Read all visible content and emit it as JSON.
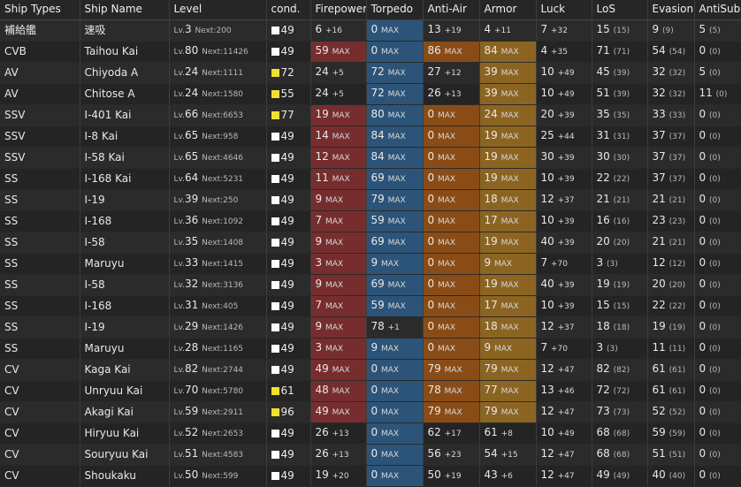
{
  "labels": {
    "lv": "Lv.",
    "next": "Next:",
    "max": "MAX"
  },
  "columns": [
    "Ship Types",
    "Ship Name",
    "Level",
    "cond.",
    "Firepower",
    "Torpedo",
    "Anti-Air",
    "Armor",
    "Luck",
    "LoS",
    "Evasion",
    "AntiSub"
  ],
  "colors": {
    "firepower_max": "#772d2d",
    "torpedo_max": "#2c5478",
    "antiair_max": "#8a4c16",
    "armor_max": "#8c6422",
    "cond_sparkle": "#f0e030",
    "cond_normal": "#ffffff"
  },
  "rows": [
    {
      "type": "補給艦",
      "name": "速吸",
      "lv": "3",
      "next": "200",
      "cond": "49",
      "condColor": "white",
      "fp": [
        "6",
        "+16"
      ],
      "tp": [
        "0",
        "MAX"
      ],
      "aa": [
        "13",
        "+19"
      ],
      "ar": [
        "4",
        "+11"
      ],
      "lk": [
        "7",
        "+32"
      ],
      "los": [
        "15",
        "(15)"
      ],
      "ev": [
        "9",
        "(9)"
      ],
      "as": [
        "5",
        "(5)"
      ]
    },
    {
      "type": "CVB",
      "name": "Taihou Kai",
      "lv": "80",
      "next": "11426",
      "cond": "49",
      "condColor": "white",
      "fp": [
        "59",
        "MAX"
      ],
      "tp": [
        "0",
        "MAX"
      ],
      "aa": [
        "86",
        "MAX"
      ],
      "ar": [
        "84",
        "MAX"
      ],
      "lk": [
        "4",
        "+35"
      ],
      "los": [
        "71",
        "(71)"
      ],
      "ev": [
        "54",
        "(54)"
      ],
      "as": [
        "0",
        "(0)"
      ]
    },
    {
      "type": "AV",
      "name": "Chiyoda A",
      "lv": "24",
      "next": "1111",
      "cond": "72",
      "condColor": "yellow",
      "fp": [
        "24",
        "+5"
      ],
      "tp": [
        "72",
        "MAX"
      ],
      "aa": [
        "27",
        "+12"
      ],
      "ar": [
        "39",
        "MAX"
      ],
      "lk": [
        "10",
        "+49"
      ],
      "los": [
        "45",
        "(39)"
      ],
      "ev": [
        "32",
        "(32)"
      ],
      "as": [
        "5",
        "(0)"
      ]
    },
    {
      "type": "AV",
      "name": "Chitose A",
      "lv": "24",
      "next": "1580",
      "cond": "55",
      "condColor": "yellow",
      "fp": [
        "24",
        "+5"
      ],
      "tp": [
        "72",
        "MAX"
      ],
      "aa": [
        "26",
        "+13"
      ],
      "ar": [
        "39",
        "MAX"
      ],
      "lk": [
        "10",
        "+49"
      ],
      "los": [
        "51",
        "(39)"
      ],
      "ev": [
        "32",
        "(32)"
      ],
      "as": [
        "11",
        "(0)"
      ]
    },
    {
      "type": "SSV",
      "name": "I-401 Kai",
      "lv": "66",
      "next": "6653",
      "cond": "77",
      "condColor": "yellow",
      "fp": [
        "19",
        "MAX"
      ],
      "tp": [
        "80",
        "MAX"
      ],
      "aa": [
        "0",
        "MAX"
      ],
      "ar": [
        "24",
        "MAX"
      ],
      "lk": [
        "20",
        "+39"
      ],
      "los": [
        "35",
        "(35)"
      ],
      "ev": [
        "33",
        "(33)"
      ],
      "as": [
        "0",
        "(0)"
      ]
    },
    {
      "type": "SSV",
      "name": "I-8 Kai",
      "lv": "65",
      "next": "958",
      "cond": "49",
      "condColor": "white",
      "fp": [
        "14",
        "MAX"
      ],
      "tp": [
        "84",
        "MAX"
      ],
      "aa": [
        "0",
        "MAX"
      ],
      "ar": [
        "19",
        "MAX"
      ],
      "lk": [
        "25",
        "+44"
      ],
      "los": [
        "31",
        "(31)"
      ],
      "ev": [
        "37",
        "(37)"
      ],
      "as": [
        "0",
        "(0)"
      ]
    },
    {
      "type": "SSV",
      "name": "I-58 Kai",
      "lv": "65",
      "next": "4646",
      "cond": "49",
      "condColor": "white",
      "fp": [
        "12",
        "MAX"
      ],
      "tp": [
        "84",
        "MAX"
      ],
      "aa": [
        "0",
        "MAX"
      ],
      "ar": [
        "19",
        "MAX"
      ],
      "lk": [
        "30",
        "+39"
      ],
      "los": [
        "30",
        "(30)"
      ],
      "ev": [
        "37",
        "(37)"
      ],
      "as": [
        "0",
        "(0)"
      ]
    },
    {
      "type": "SS",
      "name": "I-168 Kai",
      "lv": "64",
      "next": "5231",
      "cond": "49",
      "condColor": "white",
      "fp": [
        "11",
        "MAX"
      ],
      "tp": [
        "69",
        "MAX"
      ],
      "aa": [
        "0",
        "MAX"
      ],
      "ar": [
        "19",
        "MAX"
      ],
      "lk": [
        "10",
        "+39"
      ],
      "los": [
        "22",
        "(22)"
      ],
      "ev": [
        "37",
        "(37)"
      ],
      "as": [
        "0",
        "(0)"
      ]
    },
    {
      "type": "SS",
      "name": "I-19",
      "lv": "39",
      "next": "250",
      "cond": "49",
      "condColor": "white",
      "fp": [
        "9",
        "MAX"
      ],
      "tp": [
        "79",
        "MAX"
      ],
      "aa": [
        "0",
        "MAX"
      ],
      "ar": [
        "18",
        "MAX"
      ],
      "lk": [
        "12",
        "+37"
      ],
      "los": [
        "21",
        "(21)"
      ],
      "ev": [
        "21",
        "(21)"
      ],
      "as": [
        "0",
        "(0)"
      ]
    },
    {
      "type": "SS",
      "name": "I-168",
      "lv": "36",
      "next": "1092",
      "cond": "49",
      "condColor": "white",
      "fp": [
        "7",
        "MAX"
      ],
      "tp": [
        "59",
        "MAX"
      ],
      "aa": [
        "0",
        "MAX"
      ],
      "ar": [
        "17",
        "MAX"
      ],
      "lk": [
        "10",
        "+39"
      ],
      "los": [
        "16",
        "(16)"
      ],
      "ev": [
        "23",
        "(23)"
      ],
      "as": [
        "0",
        "(0)"
      ]
    },
    {
      "type": "SS",
      "name": "I-58",
      "lv": "35",
      "next": "1408",
      "cond": "49",
      "condColor": "white",
      "fp": [
        "9",
        "MAX"
      ],
      "tp": [
        "69",
        "MAX"
      ],
      "aa": [
        "0",
        "MAX"
      ],
      "ar": [
        "19",
        "MAX"
      ],
      "lk": [
        "40",
        "+39"
      ],
      "los": [
        "20",
        "(20)"
      ],
      "ev": [
        "21",
        "(21)"
      ],
      "as": [
        "0",
        "(0)"
      ]
    },
    {
      "type": "SS",
      "name": "Maruyu",
      "lv": "33",
      "next": "1415",
      "cond": "49",
      "condColor": "white",
      "fp": [
        "3",
        "MAX"
      ],
      "tp": [
        "9",
        "MAX"
      ],
      "aa": [
        "0",
        "MAX"
      ],
      "ar": [
        "9",
        "MAX"
      ],
      "lk": [
        "7",
        "+70"
      ],
      "los": [
        "3",
        "(3)"
      ],
      "ev": [
        "12",
        "(12)"
      ],
      "as": [
        "0",
        "(0)"
      ]
    },
    {
      "type": "SS",
      "name": "I-58",
      "lv": "32",
      "next": "3136",
      "cond": "49",
      "condColor": "white",
      "fp": [
        "9",
        "MAX"
      ],
      "tp": [
        "69",
        "MAX"
      ],
      "aa": [
        "0",
        "MAX"
      ],
      "ar": [
        "19",
        "MAX"
      ],
      "lk": [
        "40",
        "+39"
      ],
      "los": [
        "19",
        "(19)"
      ],
      "ev": [
        "20",
        "(20)"
      ],
      "as": [
        "0",
        "(0)"
      ]
    },
    {
      "type": "SS",
      "name": "I-168",
      "lv": "31",
      "next": "405",
      "cond": "49",
      "condColor": "white",
      "fp": [
        "7",
        "MAX"
      ],
      "tp": [
        "59",
        "MAX"
      ],
      "aa": [
        "0",
        "MAX"
      ],
      "ar": [
        "17",
        "MAX"
      ],
      "lk": [
        "10",
        "+39"
      ],
      "los": [
        "15",
        "(15)"
      ],
      "ev": [
        "22",
        "(22)"
      ],
      "as": [
        "0",
        "(0)"
      ]
    },
    {
      "type": "SS",
      "name": "I-19",
      "lv": "29",
      "next": "1426",
      "cond": "49",
      "condColor": "white",
      "fp": [
        "9",
        "MAX"
      ],
      "tp": [
        "78",
        "+1"
      ],
      "aa": [
        "0",
        "MAX"
      ],
      "ar": [
        "18",
        "MAX"
      ],
      "lk": [
        "12",
        "+37"
      ],
      "los": [
        "18",
        "(18)"
      ],
      "ev": [
        "19",
        "(19)"
      ],
      "as": [
        "0",
        "(0)"
      ]
    },
    {
      "type": "SS",
      "name": "Maruyu",
      "lv": "28",
      "next": "1165",
      "cond": "49",
      "condColor": "white",
      "fp": [
        "3",
        "MAX"
      ],
      "tp": [
        "9",
        "MAX"
      ],
      "aa": [
        "0",
        "MAX"
      ],
      "ar": [
        "9",
        "MAX"
      ],
      "lk": [
        "7",
        "+70"
      ],
      "los": [
        "3",
        "(3)"
      ],
      "ev": [
        "11",
        "(11)"
      ],
      "as": [
        "0",
        "(0)"
      ]
    },
    {
      "type": "CV",
      "name": "Kaga Kai",
      "lv": "82",
      "next": "2744",
      "cond": "49",
      "condColor": "white",
      "fp": [
        "49",
        "MAX"
      ],
      "tp": [
        "0",
        "MAX"
      ],
      "aa": [
        "79",
        "MAX"
      ],
      "ar": [
        "79",
        "MAX"
      ],
      "lk": [
        "12",
        "+47"
      ],
      "los": [
        "82",
        "(82)"
      ],
      "ev": [
        "61",
        "(61)"
      ],
      "as": [
        "0",
        "(0)"
      ]
    },
    {
      "type": "CV",
      "name": "Unryuu Kai",
      "lv": "70",
      "next": "5780",
      "cond": "61",
      "condColor": "yellow",
      "fp": [
        "48",
        "MAX"
      ],
      "tp": [
        "0",
        "MAX"
      ],
      "aa": [
        "78",
        "MAX"
      ],
      "ar": [
        "77",
        "MAX"
      ],
      "lk": [
        "13",
        "+46"
      ],
      "los": [
        "72",
        "(72)"
      ],
      "ev": [
        "61",
        "(61)"
      ],
      "as": [
        "0",
        "(0)"
      ]
    },
    {
      "type": "CV",
      "name": "Akagi Kai",
      "lv": "59",
      "next": "2911",
      "cond": "96",
      "condColor": "yellow",
      "fp": [
        "49",
        "MAX"
      ],
      "tp": [
        "0",
        "MAX"
      ],
      "aa": [
        "79",
        "MAX"
      ],
      "ar": [
        "79",
        "MAX"
      ],
      "lk": [
        "12",
        "+47"
      ],
      "los": [
        "73",
        "(73)"
      ],
      "ev": [
        "52",
        "(52)"
      ],
      "as": [
        "0",
        "(0)"
      ]
    },
    {
      "type": "CV",
      "name": "Hiryuu Kai",
      "lv": "52",
      "next": "2653",
      "cond": "49",
      "condColor": "white",
      "fp": [
        "26",
        "+13"
      ],
      "tp": [
        "0",
        "MAX"
      ],
      "aa": [
        "62",
        "+17"
      ],
      "ar": [
        "61",
        "+8"
      ],
      "lk": [
        "10",
        "+49"
      ],
      "los": [
        "68",
        "(68)"
      ],
      "ev": [
        "59",
        "(59)"
      ],
      "as": [
        "0",
        "(0)"
      ]
    },
    {
      "type": "CV",
      "name": "Souryuu Kai",
      "lv": "51",
      "next": "4583",
      "cond": "49",
      "condColor": "white",
      "fp": [
        "26",
        "+13"
      ],
      "tp": [
        "0",
        "MAX"
      ],
      "aa": [
        "56",
        "+23"
      ],
      "ar": [
        "54",
        "+15"
      ],
      "lk": [
        "12",
        "+47"
      ],
      "los": [
        "68",
        "(68)"
      ],
      "ev": [
        "51",
        "(51)"
      ],
      "as": [
        "0",
        "(0)"
      ]
    },
    {
      "type": "CV",
      "name": "Shoukaku",
      "lv": "50",
      "next": "599",
      "cond": "49",
      "condColor": "white",
      "fp": [
        "19",
        "+20"
      ],
      "tp": [
        "0",
        "MAX"
      ],
      "aa": [
        "50",
        "+19"
      ],
      "ar": [
        "43",
        "+6"
      ],
      "lk": [
        "12",
        "+47"
      ],
      "los": [
        "49",
        "(49)"
      ],
      "ev": [
        "40",
        "(40)"
      ],
      "as": [
        "0",
        "(0)"
      ]
    }
  ]
}
